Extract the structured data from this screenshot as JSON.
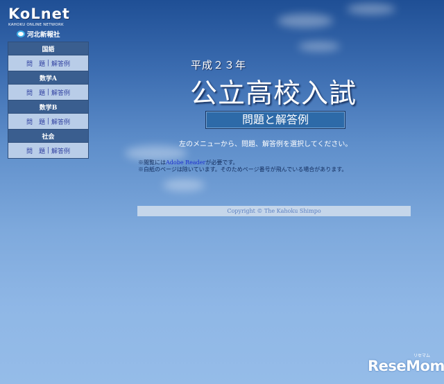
{
  "logo": {
    "main": "KoLnet",
    "sub": "KAHOKU ONLINE NETWORK",
    "company": "河北新報社"
  },
  "sidebar": {
    "categories": [
      {
        "name": "国語",
        "problem": "問　題",
        "answer": "解答例"
      },
      {
        "name": "数学A",
        "problem": "問　題",
        "answer": "解答例"
      },
      {
        "name": "数学B",
        "problem": "問　題",
        "answer": "解答例"
      },
      {
        "name": "社会",
        "problem": "問　題",
        "answer": "解答例"
      }
    ],
    "separator": "|"
  },
  "main": {
    "year_title": "平成２３年",
    "title": "公立高校入試",
    "subtitle": "問題と解答例",
    "instruction": "左のメニューから、問題、解答例を選択してください。",
    "note1_prefix": "※閲覧には",
    "note1_link": "Adobe Reader",
    "note1_suffix": "が必要です。",
    "note2": "※白紙のページは除いています。そのためページ番号が飛んでいる場合があります。",
    "copyright": "Copyright © The Kahoku Shimpo"
  },
  "watermark": {
    "text": "ReseMom",
    "kana": "リセマム"
  }
}
